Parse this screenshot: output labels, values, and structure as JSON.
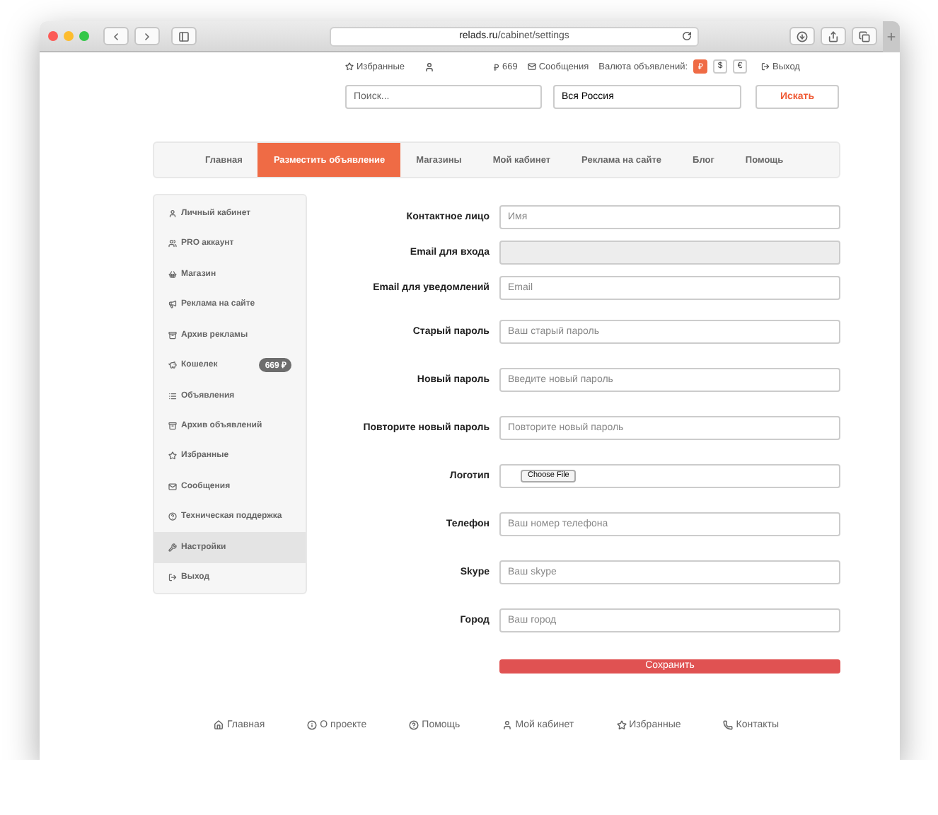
{
  "browser": {
    "url_host": "relads.ru",
    "url_path": "/cabinet/settings"
  },
  "topbar": {
    "favorites": "Избранные",
    "balance_sign": "₽",
    "balance": "669",
    "messages": "Сообщения",
    "currency_label": "Валюта объявлений:",
    "currencies": [
      {
        "label": "₽",
        "selected": true
      },
      {
        "label": "$",
        "selected": false
      },
      {
        "label": "€",
        "selected": false
      }
    ],
    "logout": "Выход"
  },
  "search": {
    "query_placeholder": "Поиск...",
    "region": "Вся Россия",
    "button": "Искать"
  },
  "nav": [
    {
      "label": "Главная",
      "selected": false
    },
    {
      "label": "Разместить объявление",
      "selected": true
    },
    {
      "label": "Магазины",
      "selected": false
    },
    {
      "label": "Мой кабинет",
      "selected": false
    },
    {
      "label": "Реклама на сайте",
      "selected": false
    },
    {
      "label": "Блог",
      "selected": false
    },
    {
      "label": "Помощь",
      "selected": false
    }
  ],
  "sidebar": {
    "items": [
      {
        "label": "Личный кабинет",
        "selected": false
      },
      {
        "label": "PRO аккаунт",
        "selected": false
      },
      {
        "label": "Магазин",
        "selected": false
      },
      {
        "label": "Реклама на сайте",
        "selected": false
      },
      {
        "label": "Архив рекламы",
        "selected": false
      },
      {
        "label": "Кошелек",
        "selected": false,
        "badge": "669 ₽"
      },
      {
        "label": "Объявления",
        "selected": false
      },
      {
        "label": "Архив объявлений",
        "selected": false
      },
      {
        "label": "Избранные",
        "selected": false
      },
      {
        "label": "Сообщения",
        "selected": false
      },
      {
        "label": "Техническая поддержка",
        "selected": false
      },
      {
        "label": "Настройки",
        "selected": true
      },
      {
        "label": "Выход",
        "selected": false
      }
    ]
  },
  "form": {
    "sections": [
      {
        "fields": [
          {
            "kind": "text",
            "label": "Контактное лицо",
            "placeholder": "Имя"
          },
          {
            "kind": "disabled",
            "label": "Email для входа"
          },
          {
            "kind": "text",
            "label": "Email для уведомлений",
            "placeholder": "Email"
          }
        ]
      },
      {
        "fields": [
          {
            "kind": "text",
            "label": "Старый пароль",
            "placeholder": "Ваш старый пароль"
          },
          {
            "kind": "text",
            "label": "Новый пароль",
            "placeholder": "Введите новый пароль"
          },
          {
            "kind": "text",
            "label": "Повторите новый пароль",
            "placeholder": "Повторите новый пароль"
          },
          {
            "kind": "file",
            "label": "Логотип",
            "button": "Choose File"
          },
          {
            "kind": "text",
            "label": "Телефон",
            "placeholder": "Ваш номер телефона"
          },
          {
            "kind": "text",
            "label": "Skype",
            "placeholder": "Ваш skype"
          },
          {
            "kind": "text",
            "label": "Город",
            "placeholder": "Ваш город"
          }
        ]
      }
    ],
    "submit": "Сохранить"
  },
  "footer": [
    "Главная",
    "О проекте",
    "Помощь",
    "Мой кабинет",
    "Избранные",
    "Контакты"
  ]
}
